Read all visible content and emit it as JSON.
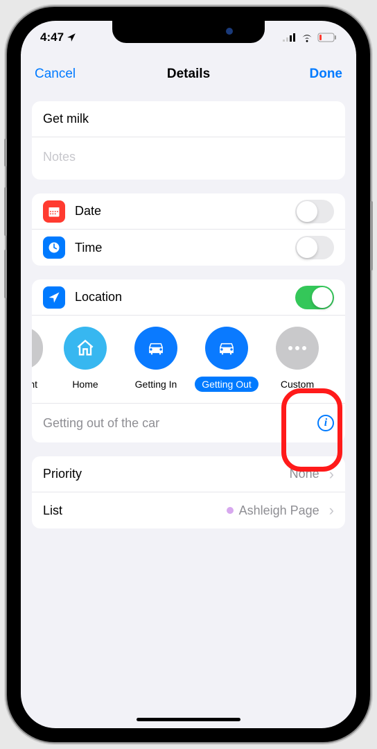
{
  "status": {
    "time": "4:47",
    "nav_icon": "location-arrow"
  },
  "nav": {
    "cancel": "Cancel",
    "title": "Details",
    "done": "Done"
  },
  "reminder": {
    "title": "Get milk",
    "notes_placeholder": "Notes"
  },
  "rows": {
    "date": {
      "label": "Date",
      "on": false
    },
    "time": {
      "label": "Time",
      "on": false
    },
    "location": {
      "label": "Location",
      "on": true
    }
  },
  "location_chips": [
    {
      "id": "current",
      "label_fragment": "nt",
      "color": "#c9c9cb"
    },
    {
      "id": "home",
      "label": "Home",
      "color": "#37b7f0"
    },
    {
      "id": "getting-in",
      "label": "Getting In",
      "color": "#0a7aff"
    },
    {
      "id": "getting-out",
      "label": "Getting Out",
      "color": "#0a7aff",
      "selected": true
    },
    {
      "id": "custom",
      "label": "Custom",
      "color": "#c9c9cb"
    }
  ],
  "location_detail": "Getting out of the car",
  "priority": {
    "label": "Priority",
    "value": "None"
  },
  "list": {
    "label": "List",
    "value": "Ashleigh Page"
  },
  "colors": {
    "accent": "#007AFF",
    "green": "#34C759",
    "date_icon": "#ff3b30",
    "time_icon": "#007AFF",
    "location_icon": "#007AFF"
  }
}
